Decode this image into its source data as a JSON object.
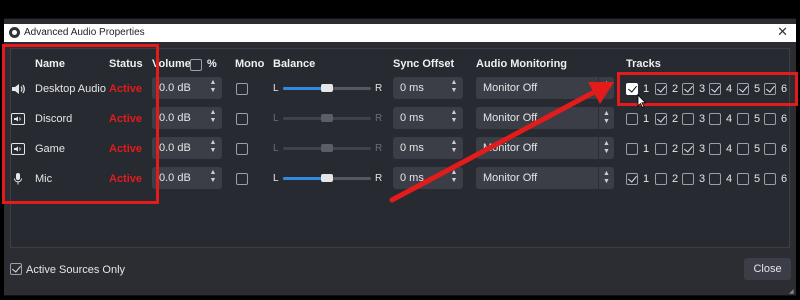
{
  "window": {
    "title": "Advanced Audio Properties",
    "close_glyph": "✕"
  },
  "headers": {
    "name": "Name",
    "status": "Status",
    "volume": "Volume",
    "volume_pct": "%",
    "mono": "Mono",
    "balance": "Balance",
    "sync_offset": "Sync Offset",
    "audio_monitoring": "Audio Monitoring",
    "tracks": "Tracks"
  },
  "balance_labels": {
    "left": "L",
    "right": "R"
  },
  "volume_percent_checked": false,
  "rows": [
    {
      "name": "Desktop Audio",
      "icon": "speaker-icon",
      "status": "Active",
      "volume": "0.0 dB",
      "mono": false,
      "balance_enabled": true,
      "balance": 0.5,
      "sync": "0 ms",
      "monitoring": "Monitor Off",
      "tracks": [
        true,
        true,
        true,
        true,
        true,
        true
      ]
    },
    {
      "name": "Discord",
      "icon": "app-capture-icon",
      "status": "Active",
      "volume": "0.0 dB",
      "mono": false,
      "balance_enabled": false,
      "balance": 0.5,
      "sync": "0 ms",
      "monitoring": "Monitor Off",
      "tracks": [
        false,
        true,
        false,
        false,
        false,
        false
      ]
    },
    {
      "name": "Game",
      "icon": "app-capture-icon",
      "status": "Active",
      "volume": "0.0 dB",
      "mono": false,
      "balance_enabled": false,
      "balance": 0.5,
      "sync": "0 ms",
      "monitoring": "Monitor Off",
      "tracks": [
        false,
        false,
        true,
        false,
        false,
        false
      ]
    },
    {
      "name": "Mic",
      "icon": "microphone-icon",
      "status": "Active",
      "volume": "0.0 dB",
      "mono": false,
      "balance_enabled": true,
      "balance": 0.5,
      "sync": "0 ms",
      "monitoring": "Monitor Off",
      "tracks": [
        true,
        false,
        false,
        false,
        false,
        false
      ]
    }
  ],
  "track_numbers": [
    "1",
    "2",
    "3",
    "4",
    "5",
    "6"
  ],
  "footer": {
    "active_sources_only_label": "Active Sources Only",
    "active_sources_only_checked": true,
    "close_label": "Close"
  },
  "colors": {
    "status_active": "#e31b1b",
    "annotation_red": "#e31b1b",
    "slider_fill": "#2f8ae0",
    "dialog_bg": "#2b2d33"
  }
}
